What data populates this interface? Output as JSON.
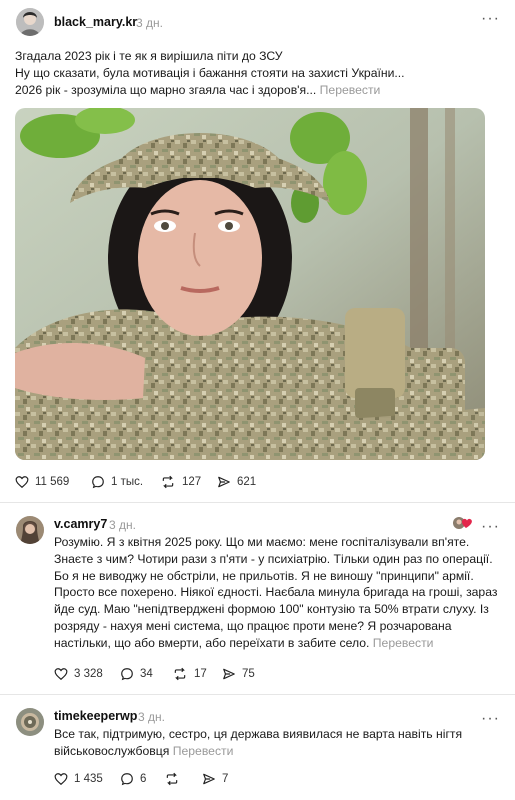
{
  "post": {
    "username": "black_mary.kr",
    "time": "3 дн.",
    "text_lines": [
      "Згадала 2023 рік і те як я вирішила піти до ЗСУ",
      "Ну що сказати, була мотивація і бажання стояти на захисті України...",
      "2026 рік - зрозуміла що марно згаяла час і здоров'я..."
    ],
    "translate": "Перевести",
    "likes": "11 569",
    "comments": "1 тыс.",
    "reposts": "127",
    "shares": "621"
  },
  "reply1": {
    "username": "v.camry7",
    "time": "3 дн.",
    "text_lines": [
      "Розумію. Я з квітня 2025 року. Що ми маємо: мене госпіталізували вп'яте.",
      "Знаєте з чим? Чотири рази з п'яти - у психіатрію. Тільки один раз по операції.",
      "Бо я не виводжу не обстріли, не прильотів. Я не виношу \"принципи\" армії.",
      "Просто все похерено. Ніякої єдності. Наєбала минула бригада на гроші, зараз",
      "йде суд. Маю \"непідтверджені формою 100\" контузію та 50% втрати слуху. Із",
      "розряду - нахуя мені система, що працює проти мене? Я розчарована",
      "настільки, що або вмерти, або переїхати в забите село."
    ],
    "translate": "Перевести",
    "likes": "3 328",
    "comments": "34",
    "reposts": "17",
    "shares": "75"
  },
  "reply2": {
    "username": "timekeeperwp",
    "time": "3 дн.",
    "text_lines": [
      "Все так, підтримую, сестро, ця держава виявилася не варта навіть нігтя",
      "військовослужбовця"
    ],
    "translate": "Перевести",
    "likes": "1 435",
    "comments": "6",
    "reposts": "",
    "shares": "7"
  },
  "colors": {
    "text": "#101010",
    "muted": "#999999",
    "divider": "#e6e6e6",
    "camo_base": "#a9a07e",
    "leaves": "#6fae3a"
  }
}
